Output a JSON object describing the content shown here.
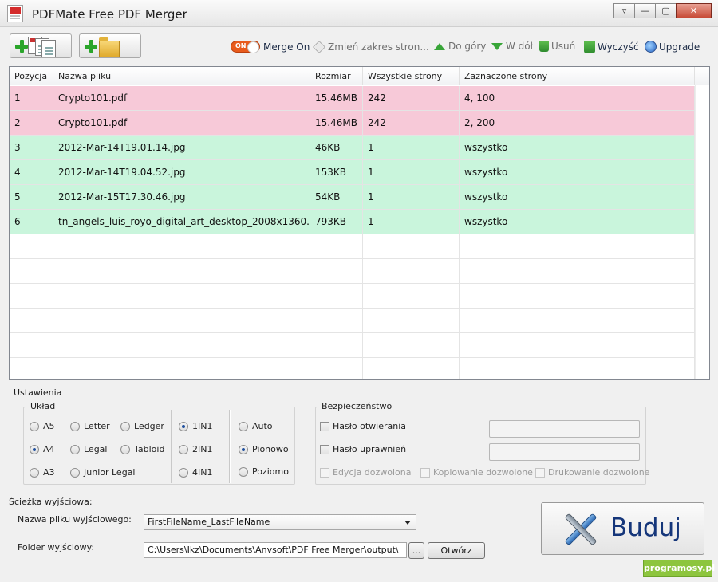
{
  "window": {
    "title": "PDFMate Free PDF Merger",
    "controls": {
      "minimize": "—",
      "maximize": "▢",
      "close": "✕"
    }
  },
  "toolbar": {
    "add_files_icon": "add-pdf-files-icon",
    "add_folder_icon": "add-folder-icon",
    "merge_toggle_state": "ON",
    "merge_label": "Merge On",
    "range_label": "Zmień zakres stron...",
    "up_label": "Do góry",
    "down_label": "W dół",
    "remove_label": "Usuń",
    "clear_label": "Wyczyść",
    "upgrade_label": "Upgrade"
  },
  "table": {
    "columns": [
      "Pozycja",
      "Nazwa pliku",
      "Rozmiar",
      "Wszystkie strony",
      "Zaznaczone strony"
    ],
    "rows": [
      {
        "pos": "1",
        "name": "Crypto101.pdf",
        "size": "15.46MB",
        "pages": "242",
        "selected": "4, 100",
        "kind": "pdf"
      },
      {
        "pos": "2",
        "name": "Crypto101.pdf",
        "size": "15.46MB",
        "pages": "242",
        "selected": "2, 200",
        "kind": "pdf"
      },
      {
        "pos": "3",
        "name": "2012-Mar-14T19.01.14.jpg",
        "size": "46KB",
        "pages": "1",
        "selected": "wszystko",
        "kind": "img"
      },
      {
        "pos": "4",
        "name": "2012-Mar-14T19.04.52.jpg",
        "size": "153KB",
        "pages": "1",
        "selected": "wszystko",
        "kind": "img"
      },
      {
        "pos": "5",
        "name": "2012-Mar-15T17.30.46.jpg",
        "size": "54KB",
        "pages": "1",
        "selected": "wszystko",
        "kind": "img"
      },
      {
        "pos": "6",
        "name": "tn_angels_luis_royo_digital_art_desktop_2008x1360...",
        "size": "793KB",
        "pages": "1",
        "selected": "wszystko",
        "kind": "img"
      }
    ],
    "row_colors": {
      "pdf": "#f7c9d8",
      "img": "#c9f5dc"
    }
  },
  "settings": {
    "title": "Ustawienia",
    "layout_title": "Układ",
    "paper": {
      "a5": "A5",
      "letter": "Letter",
      "ledger": "Ledger",
      "a4": "A4",
      "legal": "Legal",
      "tabloid": "Tabloid",
      "a3": "A3",
      "junior_legal": "Junior Legal",
      "selected": "A4"
    },
    "nup": {
      "one": "1IN1",
      "two": "2IN1",
      "four": "4IN1",
      "selected": "1IN1"
    },
    "orientation": {
      "auto": "Auto",
      "portrait": "Pionowo",
      "landscape": "Poziomo",
      "selected": "Pionowo"
    }
  },
  "security": {
    "title": "Bezpieczeństwo",
    "open_password": "Hasło otwierania",
    "permissions_password": "Hasło uprawnień",
    "allow_edit": "Edycja dozwolona",
    "allow_copy": "Kopiowanie dozwolone",
    "allow_print": "Drukowanie dozwolone"
  },
  "output": {
    "title": "Ścieżka wyjściowa:",
    "filename_label": "Nazwa pliku wyjściowego:",
    "filename_value": "FirstFileName_LastFileName",
    "folder_label": "Folder wyjściowy:",
    "folder_value": "C:\\Users\\Ikz\\Documents\\Anvsoft\\PDF Free Merger\\output\\",
    "browse_label": "...",
    "open_label": "Otwórz"
  },
  "build": {
    "label": "Buduj",
    "icon": "tools-icon"
  },
  "watermark": "programosy.pl"
}
